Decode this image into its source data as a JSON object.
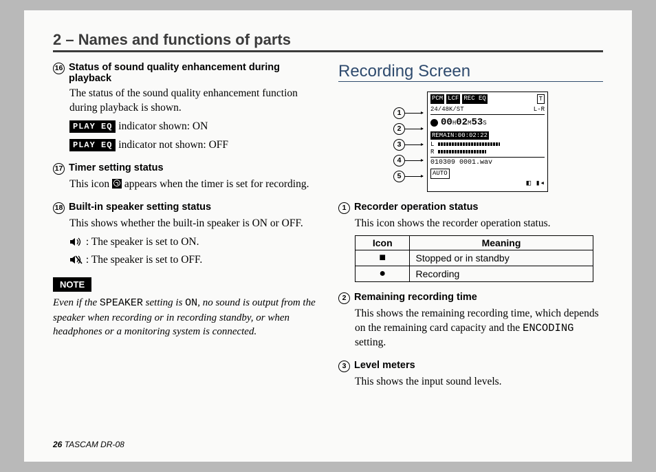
{
  "chapter": "2 – Names and functions of parts",
  "left": {
    "item16": {
      "num": "16",
      "title": "Status of sound quality enhancement during playback",
      "desc": "The status of the sound quality enhancement function during playback is shown.",
      "badge": "PLAY EQ",
      "line_on": "indicator shown: ON",
      "line_off": "indicator not shown: OFF"
    },
    "item17": {
      "num": "17",
      "title": "Timer setting status",
      "desc_a": "This icon ",
      "desc_b": " appears when the timer is set for recording."
    },
    "item18": {
      "num": "18",
      "title": "Built-in speaker setting status",
      "desc": "This shows whether the built-in speaker is ON or OFF.",
      "on": ": The speaker is set to ON.",
      "off": ": The speaker is set to OFF."
    },
    "note": {
      "label": "NOTE",
      "text_a": "Even if the ",
      "mono1": "SPEAKER",
      "text_b": " setting is ",
      "mono2": "ON",
      "text_c": ", no sound is output from the speaker when recording or in recording standby, or when headphones or a monitoring system is connected."
    }
  },
  "right": {
    "section": "Recording Screen",
    "screen": {
      "top_tags": [
        "PCM",
        "LCF",
        "REC EQ"
      ],
      "top_corner": "T",
      "row2_left": "24/48K/ST",
      "row2_right": "L-R",
      "time_h": "00",
      "time_m": "02",
      "time_s": "53",
      "h": "H",
      "m": "M",
      "s": "S",
      "remain": "REMAIN:00:02:22",
      "meterL": "L",
      "meterR": "R",
      "fname": "010309 0001.wav",
      "auto": "AUTO",
      "bottom_icons": "◧ ▮◂"
    },
    "callouts": [
      "1",
      "2",
      "3",
      "4",
      "5"
    ],
    "item1": {
      "num": "1",
      "title": "Recorder operation status",
      "desc": "This icon shows the recorder operation status.",
      "th_icon": "Icon",
      "th_meaning": "Meaning",
      "rows": [
        {
          "icon": "■",
          "meaning": "Stopped or in standby"
        },
        {
          "icon": "●",
          "meaning": "Recording"
        }
      ]
    },
    "item2": {
      "num": "2",
      "title": "Remaining recording time",
      "desc_a": "This shows the remaining recording time, which depends on the remaining card capacity and the ",
      "mono": "ENCODING",
      "desc_b": " setting."
    },
    "item3": {
      "num": "3",
      "title": "Level meters",
      "desc": "This shows the input sound levels."
    }
  },
  "footer": {
    "page": "26",
    "model": "TASCAM  DR-08"
  }
}
